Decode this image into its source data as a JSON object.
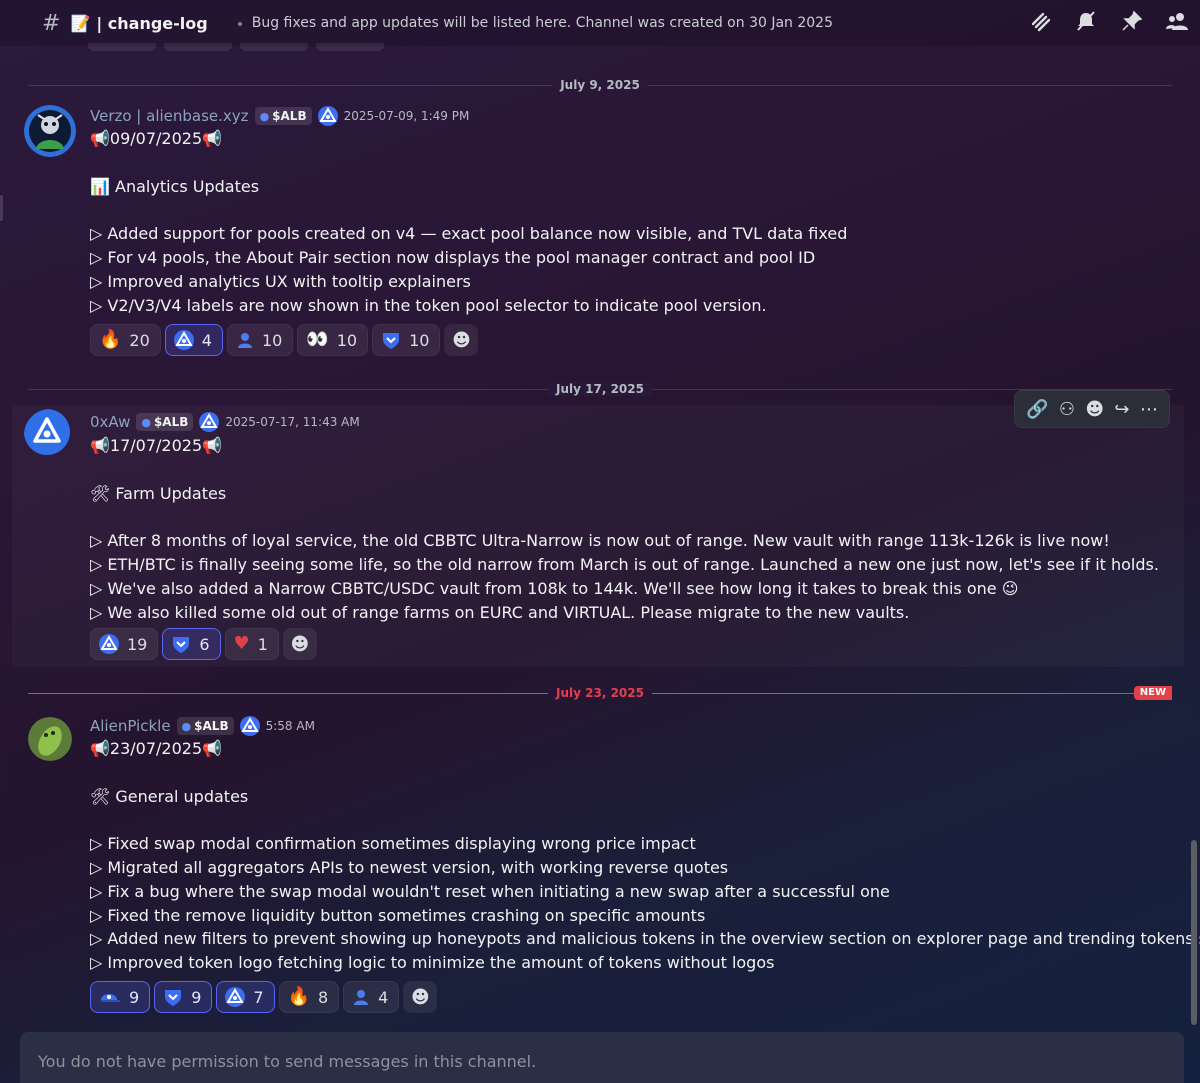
{
  "header": {
    "channel_prefix": "#",
    "channel_icon": "📝",
    "channel_name": "| change-log",
    "topic": "Bug fixes and app updates will be listed here. Channel was created on 30 Jan 2025",
    "icons": [
      "threads-icon",
      "mute-icon",
      "pin-icon",
      "members-icon"
    ]
  },
  "dividers": [
    {
      "label": "July 9, 2025"
    },
    {
      "label": "July 17, 2025"
    },
    {
      "label": "July 23, 2025",
      "new": "NEW"
    }
  ],
  "messages": [
    {
      "username": "Verzo | alienbase.xyz",
      "tag": "$ALB",
      "time": "2025-07-09, 1:49 PM",
      "lines": [
        "📢09/07/2025📢",
        "",
        "📊 Analytics Updates",
        "",
        "▷ Added support for pools created on v4 — exact pool balance now visible, and TVL data fixed",
        "▷ For v4 pools, the About Pair section now displays the pool manager contract and pool ID",
        "▷ Improved analytics UX with tooltip explainers",
        "▷ V2/V3/V4 labels are now shown in the token pool selector to indicate pool version."
      ],
      "reactions": [
        {
          "emoji": "🔥",
          "count": "20",
          "active": false
        },
        {
          "emoji": "alienbase-icon",
          "count": "4",
          "active": true
        },
        {
          "emoji": "👤",
          "count": "10",
          "active": false
        },
        {
          "emoji": "👀",
          "count": "10",
          "active": false
        },
        {
          "emoji": "🛡",
          "count": "10",
          "active": false
        }
      ]
    },
    {
      "username": "0xAw",
      "tag": "$ALB",
      "time": "2025-07-17, 11:43 AM",
      "lines": [
        "📢17/07/2025📢",
        "",
        "🛠 Farm Updates",
        "",
        "▷ After 8 months of loyal service, the old CBBTC Ultra-Narrow is now out of range. New vault with range 113k-126k is live now!",
        "▷ ETH/BTC is finally seeing some life, so the old narrow from March is out of range. Launched a new one just now, let's see if it holds.",
        "▷ We've also added a Narrow CBBTC/USDC vault from 108k to 144k. We'll see how long it takes to break this one 😉",
        "▷ We also killed some old out of range farms on EURC and VIRTUAL. Please migrate to the new vaults."
      ],
      "reactions": [
        {
          "emoji": "alienbase-icon",
          "count": "19",
          "active": false
        },
        {
          "emoji": "🛡",
          "count": "6",
          "active": true
        },
        {
          "emoji": "❤️",
          "count": "1",
          "active": false
        }
      ]
    },
    {
      "username": "AlienPickle",
      "tag": "$ALB",
      "time": "5:58 AM",
      "lines": [
        "📢23/07/2025📢",
        "",
        "🛠 General updates",
        "",
        "▷ Fixed swap modal confirmation sometimes displaying wrong price impact",
        "▷ Migrated all aggregators APIs to newest version, with working reverse quotes",
        "▷ Fix a bug where the swap modal wouldn't reset when initiating a new swap after a successful one",
        "▷ Fixed the remove liquidity button sometimes crashing on specific amounts",
        "▷ Added new filters to prevent showing up honeypots and malicious tokens in the overview section on explorer page and trending tokens section",
        "▷ Improved token logo fetching logic to minimize the amount of tokens without logos"
      ],
      "reactions": [
        {
          "emoji": "🧢",
          "count": "9",
          "active": true
        },
        {
          "emoji": "🛡",
          "count": "9",
          "active": true
        },
        {
          "emoji": "alienbase-icon",
          "count": "7",
          "active": true
        },
        {
          "emoji": "🔥",
          "count": "8",
          "active": false
        },
        {
          "emoji": "👤",
          "count": "4",
          "active": false
        }
      ]
    }
  ],
  "toolbar": {
    "icons": [
      "link-icon",
      "thread-icon",
      "add-reaction-icon",
      "forward-icon",
      "more-icon"
    ]
  },
  "composer": {
    "placeholder": "You do not have permission to send messages in this channel."
  }
}
